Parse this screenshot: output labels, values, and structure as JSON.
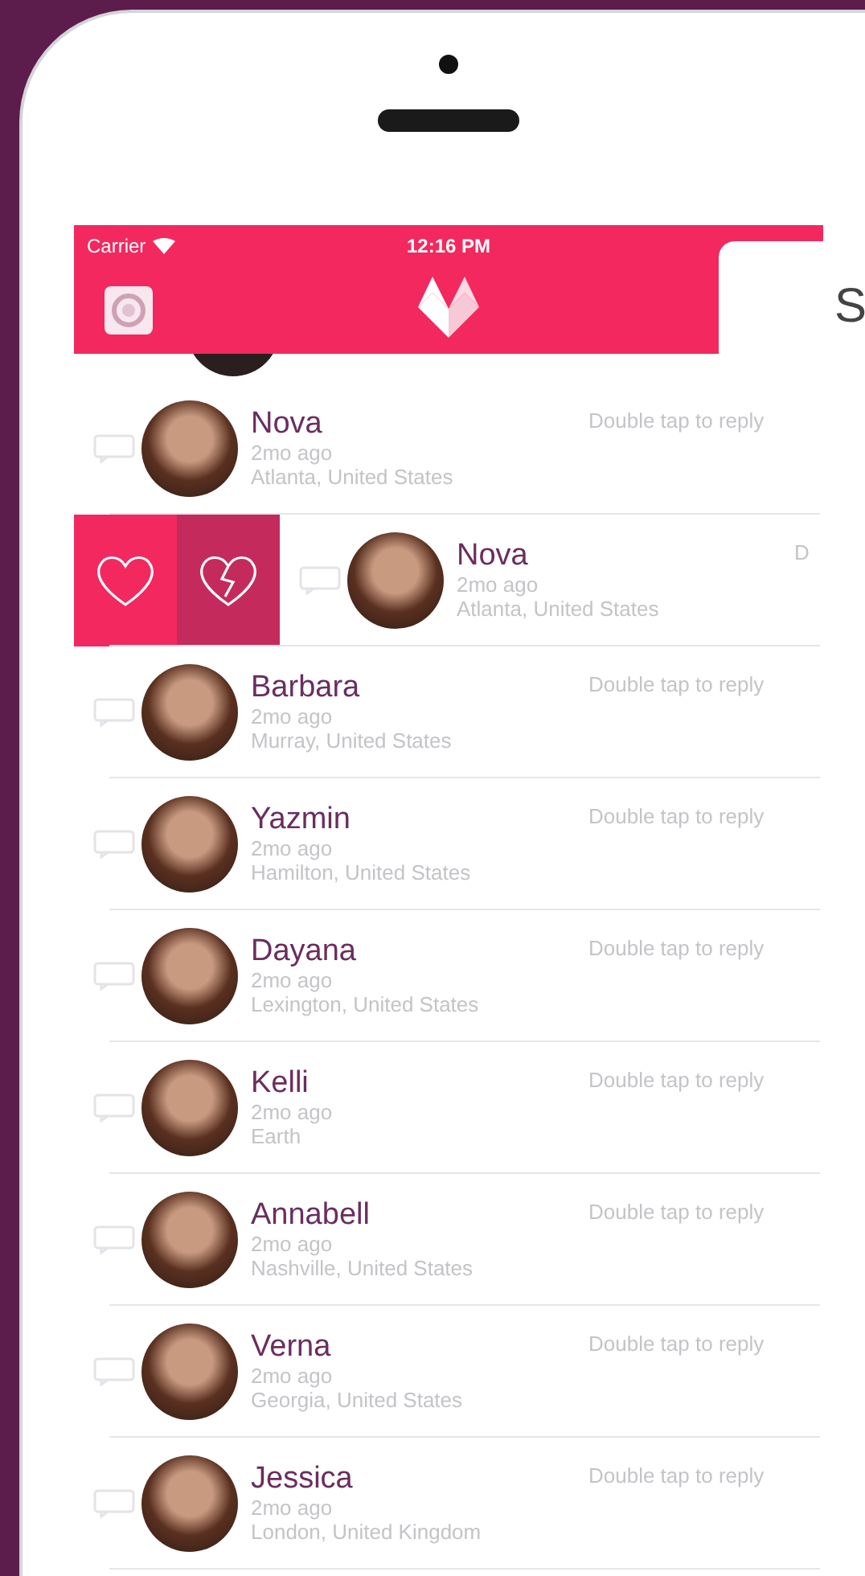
{
  "status_bar": {
    "carrier": "Carrier",
    "time": "12:16 PM"
  },
  "side_card": {
    "text": "S"
  },
  "rows": [
    {
      "name": "Nova",
      "time": "2mo ago",
      "location": "Atlanta, United States",
      "hint": "Double tap to reply",
      "swiped": false
    },
    {
      "name": "Nova",
      "time": "2mo ago",
      "location": "Atlanta, United States",
      "hint": "D",
      "swiped": true
    },
    {
      "name": "Barbara",
      "time": "2mo ago",
      "location": "Murray, United States",
      "hint": "Double tap to reply",
      "swiped": false
    },
    {
      "name": "Yazmin",
      "time": "2mo ago",
      "location": "Hamilton, United States",
      "hint": "Double tap to reply",
      "swiped": false
    },
    {
      "name": "Dayana",
      "time": "2mo ago",
      "location": "Lexington, United States",
      "hint": "Double tap to reply",
      "swiped": false
    },
    {
      "name": "Kelli",
      "time": "2mo ago",
      "location": "Earth",
      "hint": "Double tap to reply",
      "swiped": false
    },
    {
      "name": "Annabell",
      "time": "2mo ago",
      "location": "Nashville, United States",
      "hint": "Double tap to reply",
      "swiped": false
    },
    {
      "name": "Verna",
      "time": "2mo ago",
      "location": "Georgia, United States",
      "hint": "Double tap to reply",
      "swiped": false
    },
    {
      "name": "Jessica",
      "time": "2mo ago",
      "location": "London, United Kingdom",
      "hint": "Double tap to reply",
      "swiped": false
    }
  ]
}
